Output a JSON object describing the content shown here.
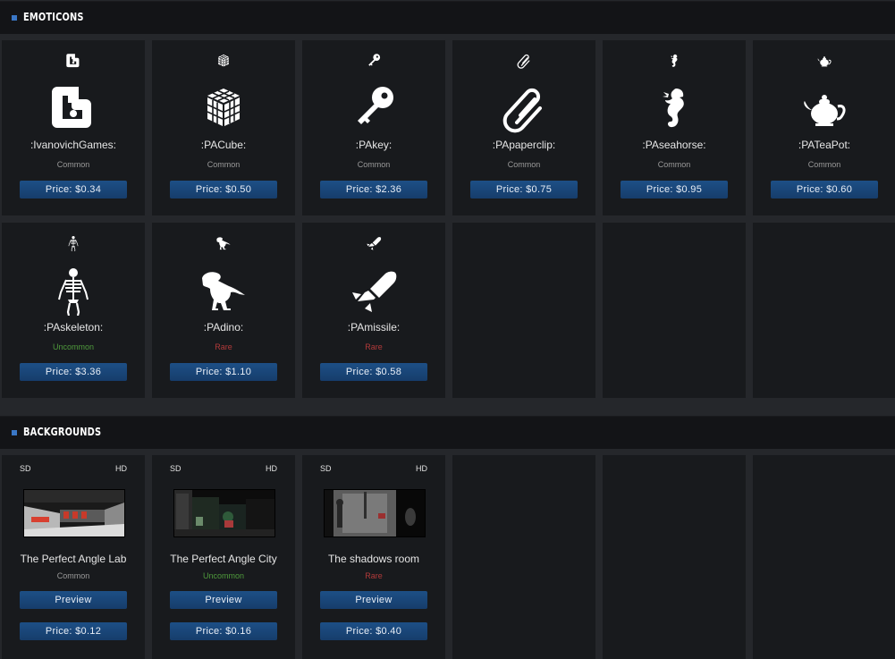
{
  "sections": {
    "emoticons": "EMOTICONS",
    "backgrounds": "BACKGROUNDS"
  },
  "emoticons": [
    {
      "name": ":IvanovichGames:",
      "rarity": "Common",
      "price": "Price: $0.34",
      "icon": "ivanovich-logo-icon"
    },
    {
      "name": ":PACube:",
      "rarity": "Common",
      "price": "Price: $0.50",
      "icon": "cube-icon"
    },
    {
      "name": ":PAkey:",
      "rarity": "Common",
      "price": "Price: $2.36",
      "icon": "key-icon"
    },
    {
      "name": ":PApaperclip:",
      "rarity": "Common",
      "price": "Price: $0.75",
      "icon": "paperclip-icon"
    },
    {
      "name": ":PAseahorse:",
      "rarity": "Common",
      "price": "Price: $0.95",
      "icon": "seahorse-icon"
    },
    {
      "name": ":PATeaPot:",
      "rarity": "Common",
      "price": "Price: $0.60",
      "icon": "teapot-icon"
    },
    {
      "name": ":PAskeleton:",
      "rarity": "Uncommon",
      "price": "Price: $3.36",
      "icon": "skeleton-icon"
    },
    {
      "name": ":PAdino:",
      "rarity": "Rare",
      "price": "Price: $1.10",
      "icon": "dino-icon"
    },
    {
      "name": ":PAmissile:",
      "rarity": "Rare",
      "price": "Price: $0.58",
      "icon": "missile-icon"
    }
  ],
  "backgrounds": [
    {
      "name": "The Perfect Angle Lab",
      "rarity": "Common",
      "preview": "Preview",
      "price": "Price: $0.12",
      "sd": "SD",
      "hd": "HD"
    },
    {
      "name": "The Perfect Angle City",
      "rarity": "Uncommon",
      "preview": "Preview",
      "price": "Price: $0.16",
      "sd": "SD",
      "hd": "HD"
    },
    {
      "name": "The shadows room",
      "rarity": "Rare",
      "preview": "Preview",
      "price": "Price: $0.40",
      "sd": "SD",
      "hd": "HD"
    }
  ],
  "colors": {
    "accent": "#3a77c6",
    "button": "#1d4f86",
    "uncommon": "#4f9a3c",
    "rare": "#b23a3a"
  }
}
